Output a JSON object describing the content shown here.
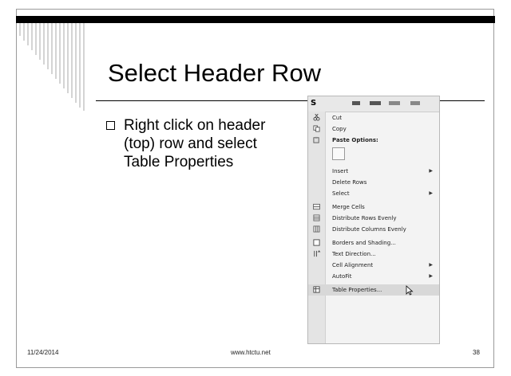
{
  "slide": {
    "title": "Select Header Row",
    "bullet": "Right click on header (top) row and select Table Properties"
  },
  "context_menu": {
    "header_letter": "S",
    "items": [
      {
        "label": "Cut",
        "icon": "scissors-icon"
      },
      {
        "label": "Copy",
        "icon": "copy-icon"
      },
      {
        "label": "Paste Options:",
        "icon": "paste-icon",
        "bold": true
      },
      {
        "label": "Insert",
        "submenu": true
      },
      {
        "label": "Delete Rows"
      },
      {
        "label": "Select",
        "submenu": true
      },
      {
        "label": "Merge Cells",
        "icon": "merge-cells-icon"
      },
      {
        "label": "Distribute Rows Evenly",
        "icon": "distribute-rows-icon"
      },
      {
        "label": "Distribute Columns Evenly",
        "icon": "distribute-columns-icon"
      },
      {
        "label": "Borders and Shading...",
        "icon": "borders-icon"
      },
      {
        "label": "Text Direction...",
        "icon": "text-direction-icon"
      },
      {
        "label": "Cell Alignment",
        "submenu": true
      },
      {
        "label": "AutoFit",
        "submenu": true
      },
      {
        "label": "Table Properties...",
        "icon": "table-properties-icon",
        "highlighted": true
      }
    ]
  },
  "footer": {
    "date": "11/24/2014",
    "website": "www.htctu.net",
    "page_number": "38"
  }
}
